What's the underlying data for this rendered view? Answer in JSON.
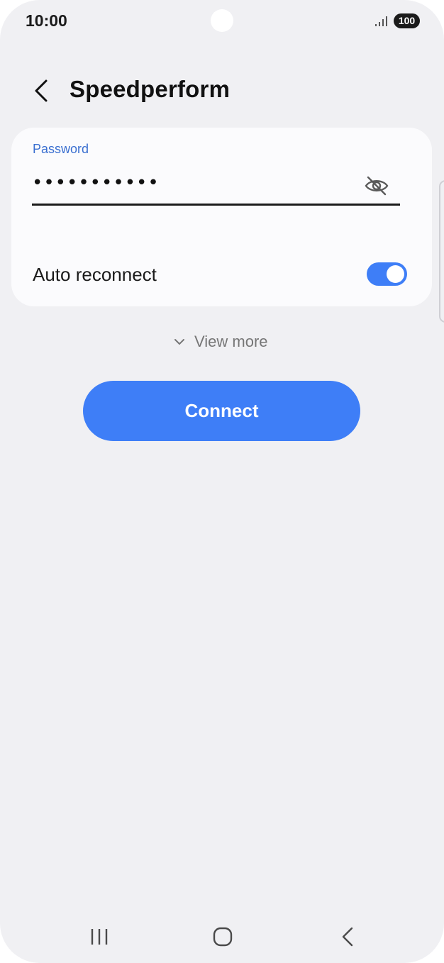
{
  "status_bar": {
    "time": "10:00",
    "battery": "100",
    "icons": [
      "signal-icon",
      "battery-icon"
    ]
  },
  "header": {
    "title": "Speedperform",
    "back_icon": "chevron-left-icon"
  },
  "password": {
    "label": "Password",
    "value": "•••••••••••",
    "visibility_icon": "eye-off-icon"
  },
  "auto_reconnect": {
    "label": "Auto reconnect",
    "enabled": true
  },
  "view_more": {
    "label": "View more",
    "icon": "chevron-down-icon"
  },
  "connect_button": {
    "label": "Connect"
  },
  "nav_bar": {
    "items": [
      "recents-icon",
      "home-icon",
      "back-icon"
    ]
  },
  "colors": {
    "accent": "#3e7ef7",
    "label_blue": "#3a6fd0",
    "background": "#f0f0f3",
    "card": "#fbfbfd"
  }
}
